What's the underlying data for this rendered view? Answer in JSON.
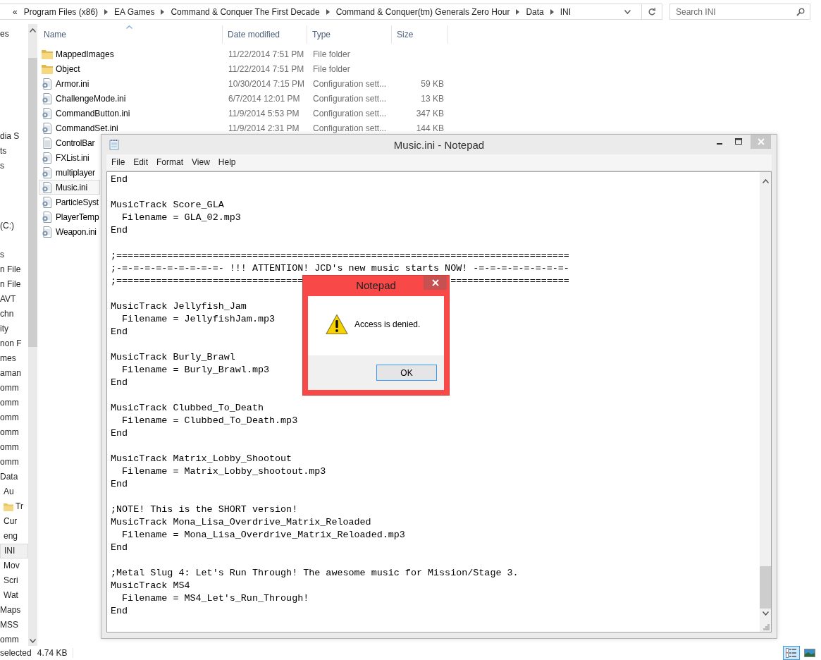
{
  "address_bar": {
    "overflow": "«",
    "crumbs": [
      "Program Files (x86)",
      "EA Games",
      "Command & Conquer The First Decade",
      "Command & Conquer(tm) Generals Zero Hour",
      "Data",
      "INI"
    ]
  },
  "search": {
    "placeholder": "Search INI"
  },
  "nav_pane": {
    "groups": [
      [
        {
          "label": "es",
          "selected": false
        }
      ],
      [
        {
          "label": "dia S",
          "selected": false
        },
        {
          "label": "ts",
          "selected": false
        },
        {
          "label": "s",
          "selected": false
        }
      ],
      [
        {
          "label": "(C:)",
          "selected": false
        }
      ],
      [
        {
          "label": "s",
          "selected": false
        },
        {
          "label": "n File",
          "selected": false
        },
        {
          "label": "n File",
          "selected": false
        },
        {
          "label": "AVT",
          "selected": false
        },
        {
          "label": "chn",
          "selected": false
        },
        {
          "label": "ity",
          "selected": false
        },
        {
          "label": "non F",
          "selected": false
        },
        {
          "label": "mes",
          "selected": false
        },
        {
          "label": "aman",
          "selected": false
        },
        {
          "label": "omm",
          "selected": false
        },
        {
          "label": "omm",
          "selected": false
        },
        {
          "label": "omm",
          "selected": false
        },
        {
          "label": "omm",
          "selected": false
        },
        {
          "label": "omm",
          "selected": false
        },
        {
          "label": "omm",
          "selected": false
        },
        {
          "label": "Data",
          "selected": false,
          "children": [
            {
              "label": "Au",
              "kind": "plain",
              "selected": false
            },
            {
              "label": "Tr",
              "kind": "folder",
              "selected": false
            },
            {
              "label": "Cur",
              "kind": "plain",
              "selected": false
            },
            {
              "label": "eng",
              "kind": "plain",
              "selected": false
            },
            {
              "label": "INI",
              "kind": "plain",
              "selected": true
            },
            {
              "label": "Mov",
              "kind": "plain",
              "selected": false
            },
            {
              "label": "Scri",
              "kind": "plain",
              "selected": false
            },
            {
              "label": "Wat",
              "kind": "plain",
              "selected": false
            }
          ]
        },
        {
          "label": "Maps",
          "selected": false
        },
        {
          "label": "MSS",
          "selected": false
        },
        {
          "label": "omm",
          "selected": false
        }
      ]
    ]
  },
  "file_list": {
    "columns": [
      "Name",
      "Date modified",
      "Type",
      "Size"
    ],
    "rows": [
      {
        "name": "MappedImages",
        "date": "11/22/2014 7:51 PM",
        "type": "File folder",
        "kind": "folder",
        "selected": false
      },
      {
        "name": "Object",
        "date": "11/22/2014 7:51 PM",
        "type": "File folder",
        "kind": "folder",
        "selected": false
      },
      {
        "name": "Armor.ini",
        "date": "10/30/2014 7:15 PM",
        "type": "Configuration sett...",
        "size": "59 KB",
        "kind": "config",
        "selected": false
      },
      {
        "name": "ChallengeMode.ini",
        "date": "6/7/2014 12:01 PM",
        "type": "Configuration sett...",
        "size": "13 KB",
        "kind": "config",
        "selected": false
      },
      {
        "name": "CommandButton.ini",
        "date": "11/9/2014 5:53 PM",
        "type": "Configuration sett...",
        "size": "347 KB",
        "kind": "config",
        "selected": false
      },
      {
        "name": "CommandSet.ini",
        "date": "11/9/2014 2:31 PM",
        "type": "Configuration sett...",
        "size": "144 KB",
        "kind": "config",
        "selected": false
      },
      {
        "name": "ControlBar",
        "kind": "text",
        "selected": false
      },
      {
        "name": "FXList.ini",
        "kind": "config",
        "selected": false
      },
      {
        "name": "multiplayer",
        "kind": "config",
        "selected": false
      },
      {
        "name": "Music.ini",
        "kind": "config",
        "selected": true
      },
      {
        "name": "ParticleSyst",
        "kind": "config",
        "selected": false
      },
      {
        "name": "PlayerTemp",
        "kind": "config",
        "selected": false
      },
      {
        "name": "Weapon.ini",
        "kind": "config",
        "selected": false
      }
    ]
  },
  "status_bar": {
    "selection": "selected",
    "size": "4.74 KB",
    "views": [
      {
        "kind": "details",
        "selected": true
      },
      {
        "kind": "large_icons",
        "selected": false
      }
    ]
  },
  "notepad": {
    "title": "Music.ini - Notepad",
    "menu": [
      "File",
      "Edit",
      "Format",
      "View",
      "Help"
    ],
    "blocks": [
      [
        "End"
      ],
      [
        "MusicTrack Score_GLA",
        "  Filename = GLA_02.mp3",
        "End"
      ],
      [
        ";================================================================================",
        ";-=-=-=-=-=-=-=-=-=- !!! ATTENTION! JCD's new music starts NOW! -=-=-=-=-=-=-=-=-",
        {
          "parts": [
            ";=================================",
            "====================="
          ]
        }
      ],
      [
        "MusicTrack Jellyfish_Jam",
        "  Filename = JellyfishJam.mp3",
        "End"
      ],
      [
        "MusicTrack Burly_Brawl",
        "  Filename = Burly_Brawl.mp3",
        "End"
      ],
      [
        "MusicTrack Clubbed_To_Death",
        "  Filename = Clubbed_To_Death.mp3",
        "End"
      ],
      [
        "MusicTrack Matrix_Lobby_Shootout",
        "  Filename = Matrix_Lobby_shootout.mp3",
        "End"
      ],
      [
        ";NOTE! This is the SHORT version!",
        "MusicTrack Mona_Lisa_Overdrive_Matrix_Reloaded",
        "  Filename = Mona_Lisa_Overdrive_Matrix_Reloaded.mp3",
        "End"
      ],
      [
        ";Metal Slug 4: Let's Run Through! The awesome music for Mission/Stage 3.",
        "MusicTrack MS4",
        "  Filename = MS4_Let's_Run_Through!",
        "End"
      ]
    ]
  },
  "dialog": {
    "title": "Notepad",
    "message": "Access is denied.",
    "buttons": [
      "OK"
    ]
  }
}
